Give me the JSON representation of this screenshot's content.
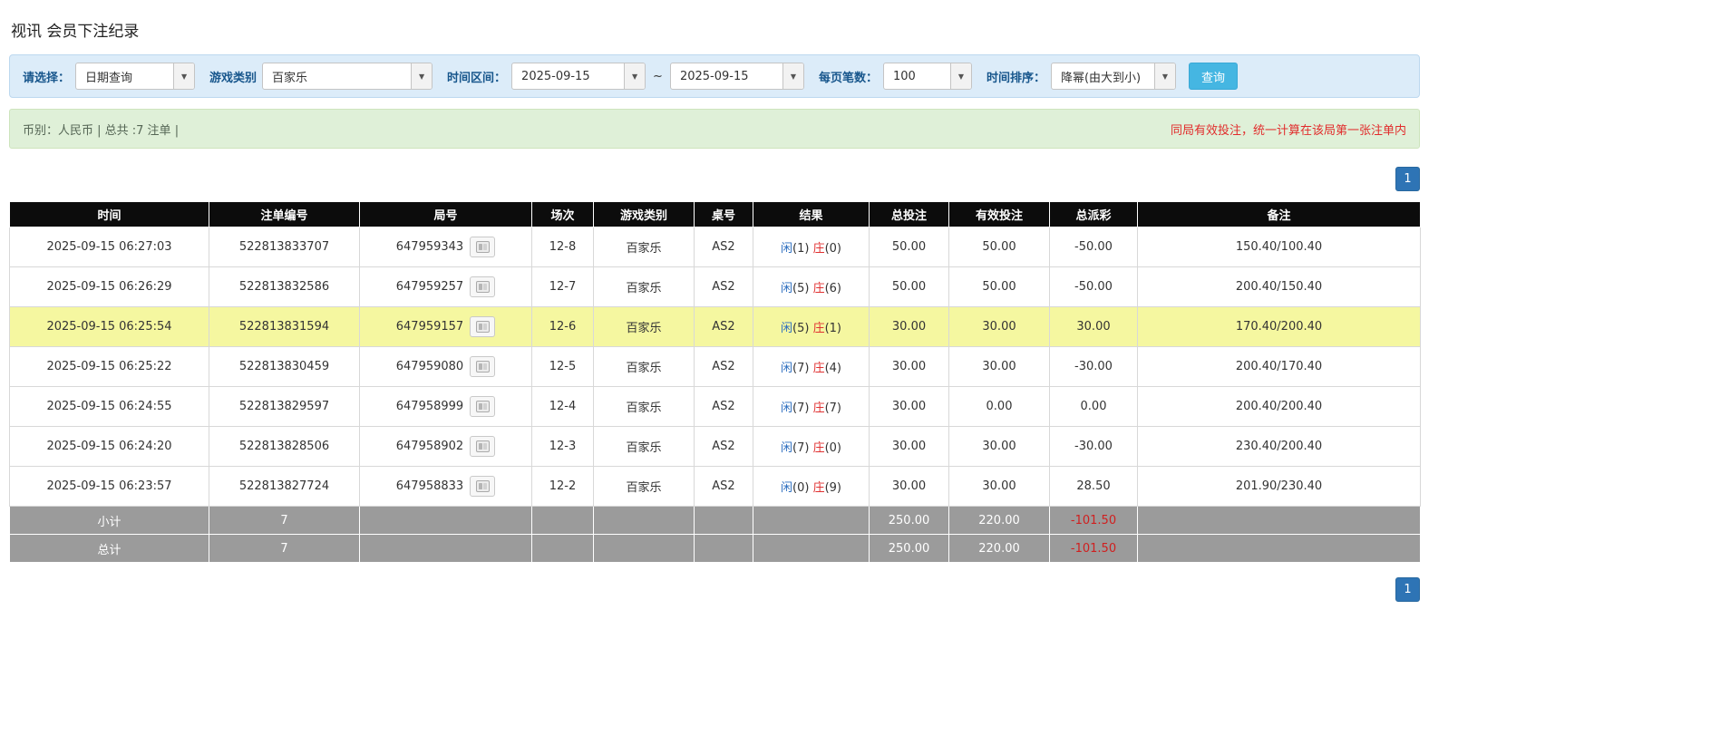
{
  "page": {
    "title": "视讯 会员下注纪录"
  },
  "filters": {
    "select_label": "请选择：",
    "select_value": "日期查询",
    "game_type_label": "游戏类别",
    "game_type_value": "百家乐",
    "range_label": "时间区间：",
    "date_from": "2025-09-15",
    "range_separator": "~",
    "date_to": "2025-09-15",
    "page_size_label": "每页笔数：",
    "page_size_value": "100",
    "sort_label": "时间排序：",
    "sort_value": "降幂(由大到小)",
    "search_button": "查询"
  },
  "summary": {
    "left": "币别：人民币 | 总共 :7 注单 |",
    "note": "同局有效投注，统一计算在该局第一张注单内"
  },
  "pagination": {
    "current_page": "1"
  },
  "colors": {
    "filter_bar_bg": "#dcecf9",
    "summary_bar_bg": "#dff0d8",
    "header_bg": "#0c0c0c",
    "highlight_row": "#f5f7a0",
    "footer_bg": "#9b9b9b",
    "player_blue": "#2e6fc0",
    "banker_red": "#e03030",
    "negative_red": "#e03030",
    "link_blue": "#337ab7",
    "pager_blue": "#2e74b5",
    "search_button_bg": "#45b6e2",
    "note_red": "#e12c2c"
  },
  "table": {
    "headers": [
      "时间",
      "注单编号",
      "局号",
      "场次",
      "游戏类别",
      "桌号",
      "结果",
      "总投注",
      "有效投注",
      "总派彩",
      "备注"
    ],
    "rows": [
      {
        "time": "2025-09-15 06:27:03",
        "bet_id": "522813833707",
        "round_id": "647959343",
        "session": "12-8",
        "game": "百家乐",
        "table_no": "AS2",
        "player": "闲",
        "player_count": "(1)",
        "banker": "庄",
        "banker_count": "(0)",
        "total_bet": "50.00",
        "valid_bet": "50.00",
        "payout": "-50.00",
        "remark": "150.40/100.40"
      },
      {
        "time": "2025-09-15 06:26:29",
        "bet_id": "522813832586",
        "round_id": "647959257",
        "session": "12-7",
        "game": "百家乐",
        "table_no": "AS2",
        "player": "闲",
        "player_count": "(5)",
        "banker": "庄",
        "banker_count": "(6)",
        "total_bet": "50.00",
        "valid_bet": "50.00",
        "payout": "-50.00",
        "remark": "200.40/150.40"
      },
      {
        "time": "2025-09-15 06:25:54",
        "bet_id": "522813831594",
        "round_id": "647959157",
        "session": "12-6",
        "game": "百家乐",
        "table_no": "AS2",
        "player": "闲",
        "player_count": "(5)",
        "banker": "庄",
        "banker_count": "(1)",
        "total_bet": "30.00",
        "valid_bet": "30.00",
        "payout": "30.00",
        "remark": "170.40/200.40"
      },
      {
        "time": "2025-09-15 06:25:22",
        "bet_id": "522813830459",
        "round_id": "647959080",
        "session": "12-5",
        "game": "百家乐",
        "table_no": "AS2",
        "player": "闲",
        "player_count": "(7)",
        "banker": "庄",
        "banker_count": "(4)",
        "total_bet": "30.00",
        "valid_bet": "30.00",
        "payout": "-30.00",
        "remark": "200.40/170.40"
      },
      {
        "time": "2025-09-15 06:24:55",
        "bet_id": "522813829597",
        "round_id": "647958999",
        "session": "12-4",
        "game": "百家乐",
        "table_no": "AS2",
        "player": "闲",
        "player_count": "(7)",
        "banker": "庄",
        "banker_count": "(7)",
        "total_bet": "30.00",
        "valid_bet": "0.00",
        "payout": "0.00",
        "remark": "200.40/200.40"
      },
      {
        "time": "2025-09-15 06:24:20",
        "bet_id": "522813828506",
        "round_id": "647958902",
        "session": "12-3",
        "game": "百家乐",
        "table_no": "AS2",
        "player": "闲",
        "player_count": "(7)",
        "banker": "庄",
        "banker_count": "(0)",
        "total_bet": "30.00",
        "valid_bet": "30.00",
        "payout": "-30.00",
        "remark": "230.40/200.40"
      },
      {
        "time": "2025-09-15 06:23:57",
        "bet_id": "522813827724",
        "round_id": "647958833",
        "session": "12-2",
        "game": "百家乐",
        "table_no": "AS2",
        "player": "闲",
        "player_count": "(0)",
        "banker": "庄",
        "banker_count": "(9)",
        "total_bet": "30.00",
        "valid_bet": "30.00",
        "payout": "28.50",
        "remark": "201.90/230.40"
      }
    ],
    "footer": [
      {
        "label": "小计",
        "count": "7",
        "total_bet": "250.00",
        "valid_bet": "220.00",
        "payout": "-101.50"
      },
      {
        "label": "总计",
        "count": "7",
        "total_bet": "250.00",
        "valid_bet": "220.00",
        "payout": "-101.50"
      }
    ]
  }
}
